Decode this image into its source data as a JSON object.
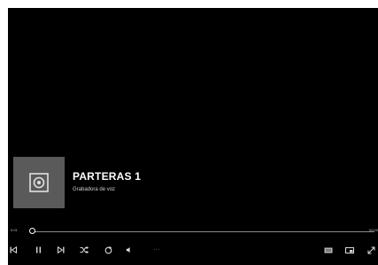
{
  "now_playing": {
    "title": "PARTERAS 1",
    "subtitle": "Grabadora de voz",
    "artwork_icon": "speaker-icon"
  },
  "seek": {
    "current_time": "0:01",
    "total_time": "00:00",
    "progress": 0.005
  },
  "controls": {
    "left": [
      "previous-icon",
      "pause-icon",
      "next-icon",
      "shuffle-icon",
      "repeat-icon",
      "volume-icon",
      "more-icon"
    ],
    "right": [
      "mini-view-icon",
      "cast-icon",
      "fullscreen-icon"
    ],
    "more_label": "···"
  },
  "colors": {
    "background": "#000000",
    "text": "#ffffff",
    "artwork": "#5a5a5a"
  }
}
